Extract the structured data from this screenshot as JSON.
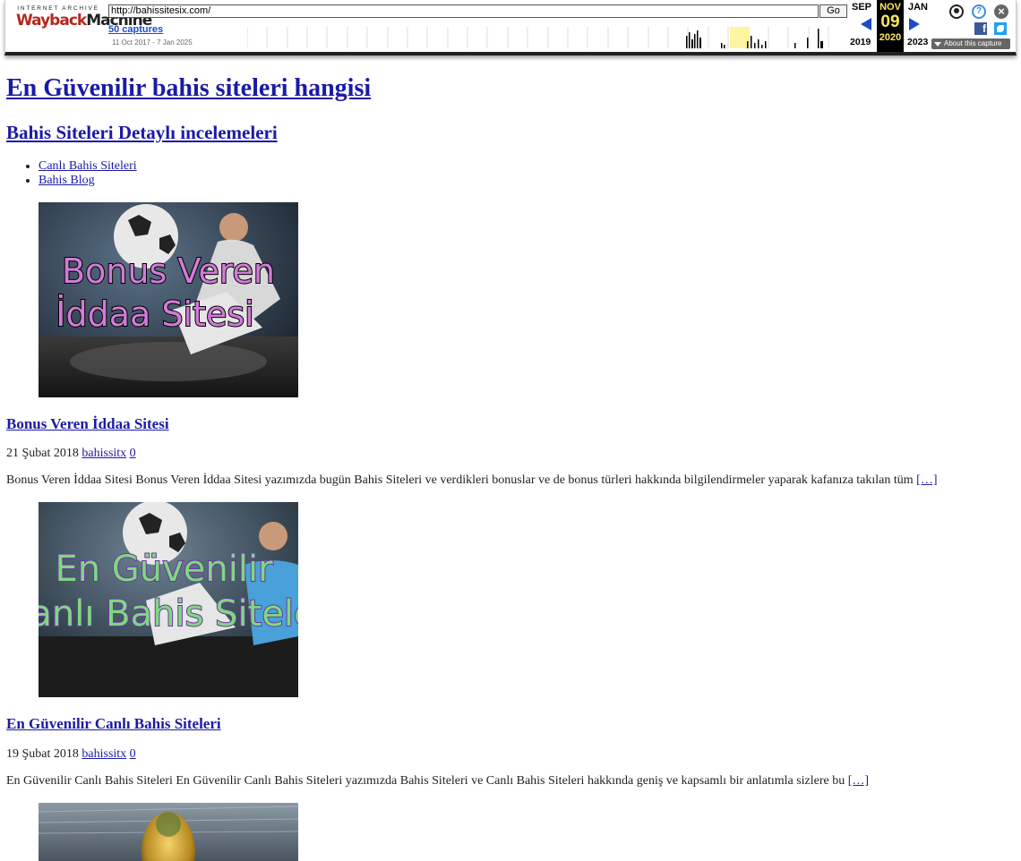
{
  "wayback": {
    "logo_top": "INTERNET ARCHIVE",
    "logo_wb_a": "Wayback",
    "logo_wb_b": "Machine",
    "url": "http://bahissitesix.com/",
    "go_label": "Go",
    "captures": "50 captures",
    "date_range": "11 Oct 2017 - 7 Jan 2025",
    "prev_month": "SEP",
    "prev_year": "2019",
    "cur_month": "NOV",
    "cur_day": "09",
    "cur_year": "2020",
    "next_month": "JAN",
    "next_year": "2023",
    "about": "About this capture",
    "help_glyph": "?",
    "close_glyph": "×",
    "fb_glyph": "f",
    "icons": [
      "user-icon",
      "help-icon",
      "close-icon",
      "facebook-icon",
      "twitter-icon",
      "prev-arrow-icon",
      "next-arrow-icon"
    ],
    "highlight_color": "#ffe85c",
    "accent_color": "#1c4ac8"
  },
  "site": {
    "title": "En Güvenilir bahis siteleri hangisi",
    "description": "Bahis Siteleri Detaylı incelemeleri",
    "menu": [
      "Canlı Bahis Siteleri",
      "Bahis Blog"
    ]
  },
  "posts": [
    {
      "image_text": [
        "Bonus Veren",
        "İddaa Sitesi"
      ],
      "title": "Bonus Veren İddaa Sitesi",
      "date": "21 Şubat 2018",
      "author": "bahissitx",
      "comments": "0",
      "excerpt": "Bonus Veren İddaa Sitesi Bonus Veren İddaa Sitesi yazımızda bugün Bahis Siteleri ve verdikleri bonuslar ve de bonus türleri hakkında bilgilendirmeler yaparak kafanıza takılan tüm",
      "more": "[…]"
    },
    {
      "image_text": [
        "En Güvenilir",
        "anlı Bahis Sitele"
      ],
      "title": "En Güvenilir Canlı Bahis Siteleri",
      "date": "19 Şubat 2018",
      "author": "bahissitx",
      "comments": "0",
      "excerpt": "En Güvenilir Canlı Bahis Siteleri En Güvenilir Canlı Bahis Siteleri yazımızda Bahis Siteleri ve Canlı Bahis Siteleri hakkında geniş ve kapsamlı bir anlatımla sizlere bu",
      "more": "[…]"
    }
  ]
}
